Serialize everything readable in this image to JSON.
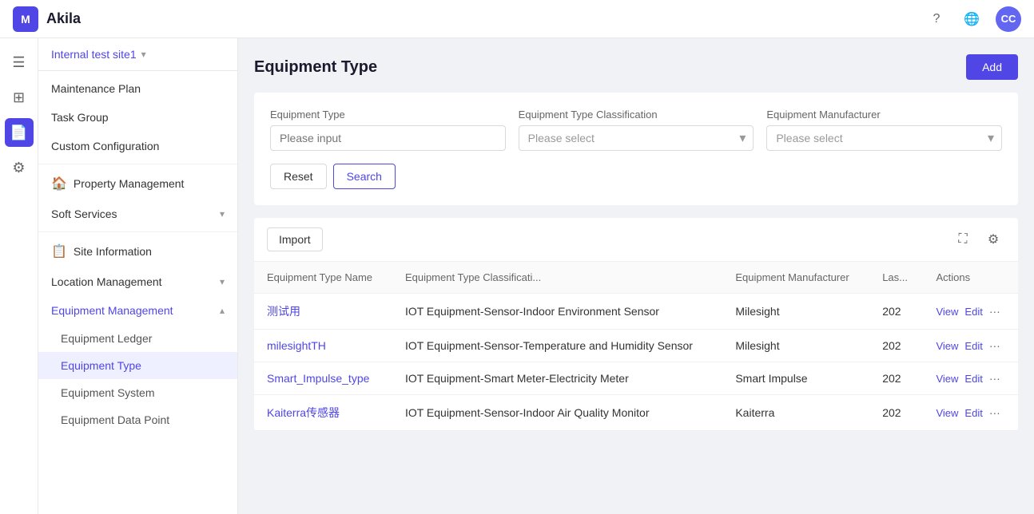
{
  "brand": {
    "logo": "M",
    "name": "Akila"
  },
  "topnav": {
    "help_icon": "?",
    "globe_icon": "🌐",
    "avatar_initials": "CC"
  },
  "icon_sidebar": {
    "items": [
      {
        "id": "menu",
        "icon": "☰",
        "active": false
      },
      {
        "id": "dashboard",
        "icon": "⊞",
        "active": false
      },
      {
        "id": "document",
        "icon": "📄",
        "active": true
      },
      {
        "id": "settings",
        "icon": "⚙",
        "active": false
      }
    ]
  },
  "sidebar": {
    "site_label": "Internal test site1",
    "items": [
      {
        "id": "maintenance-plan",
        "label": "Maintenance Plan",
        "level": 1,
        "active": false
      },
      {
        "id": "task-group",
        "label": "Task Group",
        "level": 1,
        "active": false
      },
      {
        "id": "custom-configuration",
        "label": "Custom Configuration",
        "level": 1,
        "active": false
      },
      {
        "id": "property-management",
        "label": "Property Management",
        "level": 0,
        "icon": "🏠",
        "active": false
      },
      {
        "id": "soft-services",
        "label": "Soft Services",
        "level": 1,
        "active": false,
        "has_arrow": true
      },
      {
        "id": "site-information",
        "label": "Site Information",
        "level": 0,
        "icon": "📋",
        "active": false
      },
      {
        "id": "location-management",
        "label": "Location Management",
        "level": 1,
        "active": false,
        "has_arrow": true
      },
      {
        "id": "equipment-management",
        "label": "Equipment Management",
        "level": 1,
        "active": true,
        "has_arrow": true,
        "expanded": true
      },
      {
        "id": "equipment-ledger",
        "label": "Equipment Ledger",
        "level": 2,
        "active": false
      },
      {
        "id": "equipment-type",
        "label": "Equipment Type",
        "level": 2,
        "active": true
      },
      {
        "id": "equipment-system",
        "label": "Equipment System",
        "level": 2,
        "active": false
      },
      {
        "id": "equipment-data-point",
        "label": "Equipment Data Point",
        "level": 2,
        "active": false
      }
    ]
  },
  "page": {
    "title": "Equipment Type",
    "add_button": "Add"
  },
  "filters": {
    "equipment_type_label": "Equipment Type",
    "equipment_type_placeholder": "Please input",
    "classification_label": "Equipment Type Classification",
    "classification_placeholder": "Please select",
    "manufacturer_label": "Equipment Manufacturer",
    "manufacturer_placeholder": "Please select",
    "reset_button": "Reset",
    "search_button": "Search"
  },
  "table": {
    "import_button": "Import",
    "columns": [
      {
        "id": "name",
        "label": "Equipment Type Name"
      },
      {
        "id": "classification",
        "label": "Equipment Type Classificati..."
      },
      {
        "id": "manufacturer",
        "label": "Equipment Manufacturer"
      },
      {
        "id": "last",
        "label": "Las..."
      },
      {
        "id": "actions",
        "label": "Actions"
      }
    ],
    "rows": [
      {
        "name": "测试用",
        "classification": "IOT Equipment-Sensor-Indoor Environment Sensor",
        "manufacturer": "Milesight",
        "last": "202",
        "view": "View",
        "edit": "Edit"
      },
      {
        "name": "milesightTH",
        "classification": "IOT Equipment-Sensor-Temperature and Humidity Sensor",
        "manufacturer": "Milesight",
        "last": "202",
        "view": "View",
        "edit": "Edit"
      },
      {
        "name": "Smart_Impulse_type",
        "classification": "IOT Equipment-Smart Meter-Electricity Meter",
        "manufacturer": "Smart Impulse",
        "last": "202",
        "view": "View",
        "edit": "Edit"
      },
      {
        "name": "Kaiterra传感器",
        "classification": "IOT Equipment-Sensor-Indoor Air Quality Monitor",
        "manufacturer": "Kaiterra",
        "last": "202",
        "view": "View",
        "edit": "Edit"
      }
    ]
  }
}
